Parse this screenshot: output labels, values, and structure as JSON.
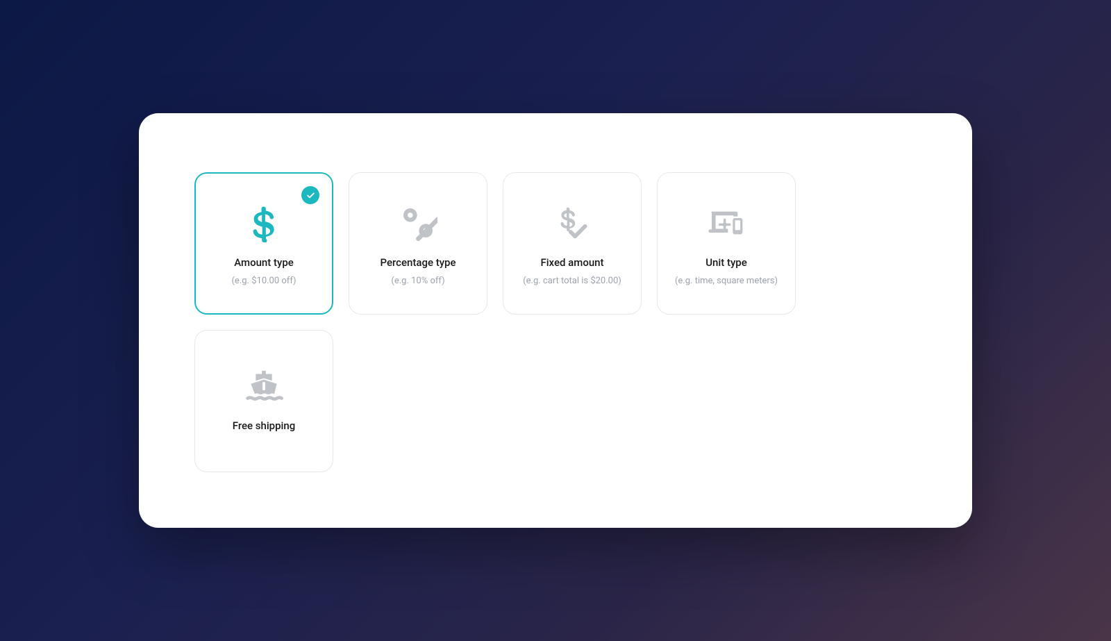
{
  "options": {
    "amount": {
      "title": "Amount type",
      "subtitle": "(e.g. $10.00 off)",
      "selected": true
    },
    "percentage": {
      "title": "Percentage type",
      "subtitle": "(e.g. 10% off)",
      "selected": false
    },
    "fixed": {
      "title": "Fixed amount",
      "subtitle": "(e.g. cart total is $20.00)",
      "selected": false
    },
    "unit": {
      "title": "Unit type",
      "subtitle": "(e.g. time, square meters)",
      "selected": false
    },
    "shipping": {
      "title": "Free shipping",
      "subtitle": "",
      "selected": false
    }
  }
}
